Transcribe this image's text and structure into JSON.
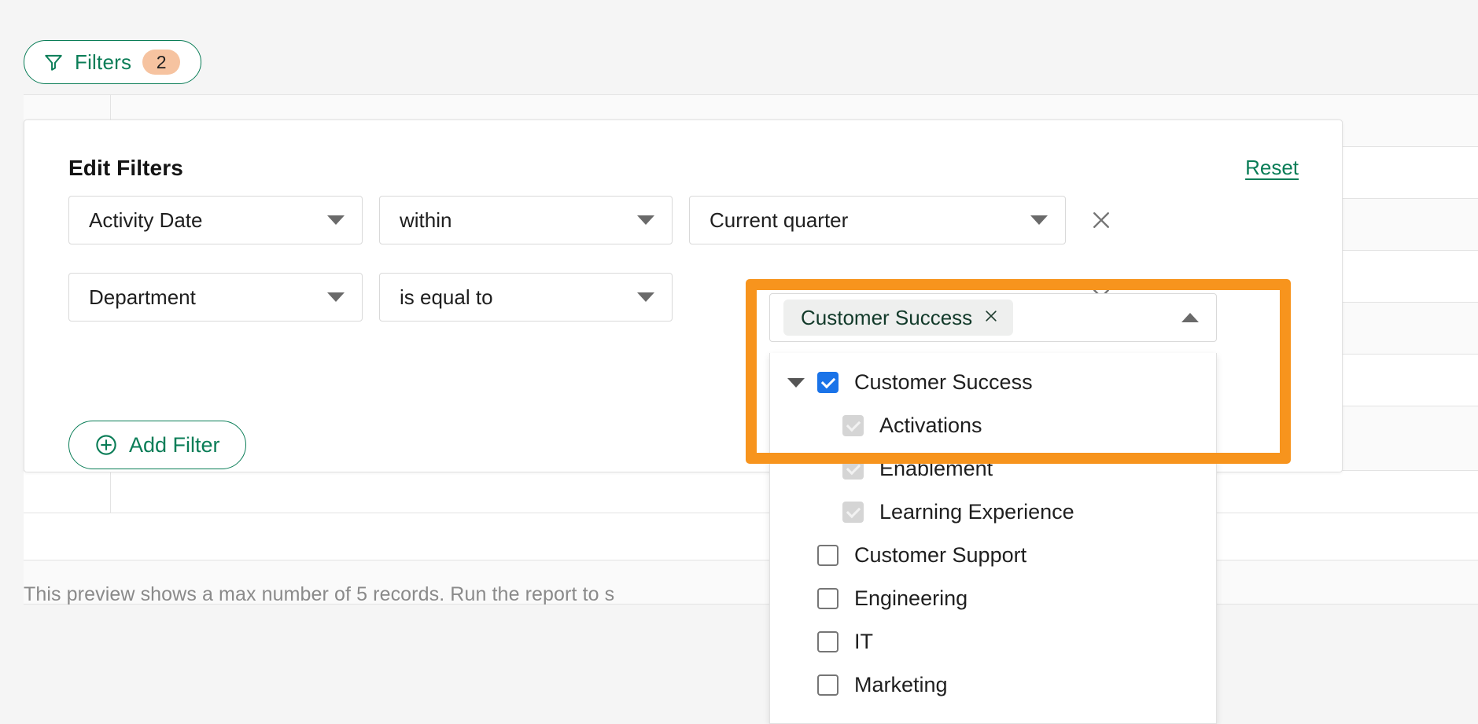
{
  "filters_button": {
    "label": "Filters",
    "count": "2",
    "icon": "funnel-icon",
    "accent_color": "#0a7d57",
    "badge_color": "#f6c3a0"
  },
  "panel": {
    "title": "Edit Filters",
    "reset_label": "Reset",
    "add_filter_label": "Add Filter",
    "add_filter_icon": "plus-circle-icon",
    "remove_icon": "close-icon",
    "rows": [
      {
        "field": "Activity Date",
        "operator": "within",
        "value": "Current quarter",
        "caret": "chevron-down-icon"
      },
      {
        "field": "Department",
        "operator": "is equal to",
        "value": "Customer Success",
        "caret": "chevron-up-icon"
      }
    ]
  },
  "department_dropdown": {
    "selected_chip": "Customer Success",
    "chip_remove_icon": "close-icon",
    "options": [
      {
        "label": "Customer Success",
        "state": "checked",
        "level": 0,
        "expander": "triangle-down-icon"
      },
      {
        "label": "Activations",
        "state": "disabled",
        "level": 1,
        "expander": ""
      },
      {
        "label": "Enablement",
        "state": "disabled",
        "level": 1,
        "expander": ""
      },
      {
        "label": "Learning Experience",
        "state": "disabled",
        "level": 1,
        "expander": ""
      },
      {
        "label": "Customer Support",
        "state": "unchecked",
        "level": 0,
        "expander": ""
      },
      {
        "label": "Engineering",
        "state": "unchecked",
        "level": 0,
        "expander": ""
      },
      {
        "label": "IT",
        "state": "unchecked",
        "level": 0,
        "expander": ""
      },
      {
        "label": "Marketing",
        "state": "unchecked",
        "level": 0,
        "expander": ""
      }
    ]
  },
  "preview_note": "This preview shows a max number of 5 records. Run the report to s",
  "highlight": {
    "color": "#f7941d"
  }
}
